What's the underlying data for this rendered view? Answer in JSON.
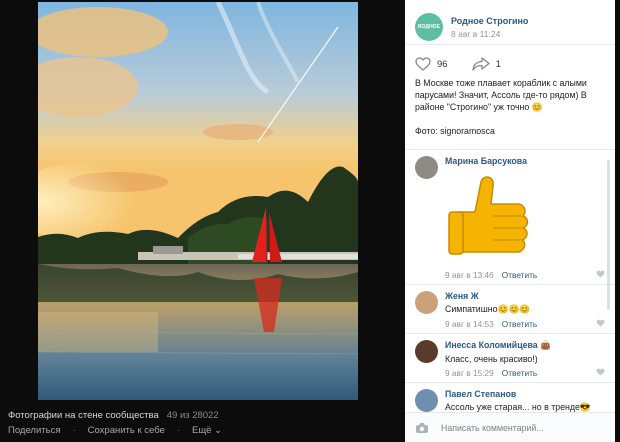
{
  "photo": {
    "alt_label": "photo"
  },
  "footer": {
    "caption": "Фотографии на стене сообщества",
    "counter": "49 из 28022",
    "share": "Поделиться",
    "save": "Сохранить к себе",
    "more": "Ещё"
  },
  "post": {
    "author": "Родное Строгино",
    "date": "8 авг в 11:24",
    "avatar_text": "ROДНОЕ",
    "likes": "96",
    "shares": "1",
    "text": "В Москве тоже плавает кораблик с алыми парусами! Значит, Ассоль где-то рядом) В районе \"Строгино\" уж точно 😊",
    "photo_credit": "Фото: signoramosca"
  },
  "comments": [
    {
      "name": "Марина Барсукова",
      "text": "",
      "date": "9 авг в 13:46",
      "reply": "Ответить",
      "avatar_color": "#8f8a82"
    },
    {
      "name": "Женя Ж",
      "text": "Симпатишно😊😊😊",
      "date": "9 авг в 14:53",
      "reply": "Ответить",
      "avatar_color": "#c9a27a"
    },
    {
      "name": "Инесса Коломийцева 👜",
      "text": "Класс, очень красиво!)",
      "date": "9 авг в 15:29",
      "reply": "Ответить",
      "avatar_color": "#5a3a2a"
    },
    {
      "name": "Павел Степанов",
      "text": "Ассоль уже старая... но в тренде😎",
      "date": "",
      "reply": "",
      "avatar_color": "#6f8fb0"
    }
  ],
  "reply_box": {
    "placeholder": "Написать комментарий..."
  },
  "colors": {
    "link": "#2a5885",
    "accent": "#5cbfa3",
    "sail": "#e3201b",
    "sticker": "#f5b400"
  }
}
